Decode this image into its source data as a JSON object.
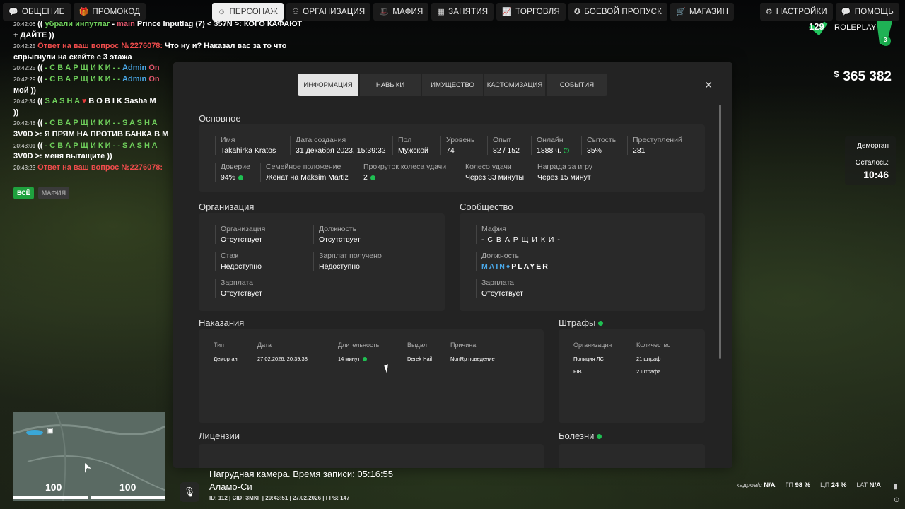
{
  "topbar": {
    "left": [
      {
        "icon": "chat-icon",
        "label": "ОБЩЕНИЕ"
      },
      {
        "icon": "promo-icon",
        "label": "ПРОМОКОД"
      }
    ],
    "center": [
      {
        "icon": "person-icon",
        "label": "ПЕРСОНАЖ",
        "active": true
      },
      {
        "icon": "org-icon",
        "label": "ОРГАНИЗАЦИЯ"
      },
      {
        "icon": "mafia-icon",
        "label": "МАФИЯ"
      },
      {
        "icon": "jobs-icon",
        "label": "ЗАНЯТИЯ"
      },
      {
        "icon": "chart-icon",
        "label": "ТОРГОВЛЯ"
      },
      {
        "icon": "pass-icon",
        "label": "БОЕВОЙ ПРОПУСК"
      },
      {
        "icon": "cart-icon",
        "label": "МАГАЗИН"
      }
    ],
    "right": [
      {
        "icon": "gear-icon",
        "label": "НАСТРОЙКИ"
      },
      {
        "icon": "help-icon",
        "label": "ПОМОЩЬ"
      }
    ]
  },
  "chat": {
    "lines": [
      {
        "ts": "20:42:06",
        "parts": [
          {
            "t": "(( ",
            "c": "#ffffff"
          },
          {
            "t": "убрали инпутлаг",
            "c": "#6fcf5b"
          },
          {
            "t": " - ",
            "c": "#ffffff"
          },
          {
            "t": "main",
            "c": "#e0556b"
          },
          {
            "t": " Prince Inputlag (7) < 357N >: КОГО КАФАЮТ",
            "c": "#ffffff"
          }
        ]
      },
      {
        "ts": "",
        "parts": [
          {
            "t": "+ ДАЙТЕ ))",
            "c": "#ffffff"
          }
        ]
      },
      {
        "ts": "20:42:25",
        "parts": [
          {
            "t": "Ответ на ваш вопрос №2276078:",
            "c": "#ef4c4c"
          },
          {
            "t": " Что ну и? Наказал вас за то что",
            "c": "#ffffff"
          }
        ]
      },
      {
        "ts": "",
        "parts": [
          {
            "t": "спрыгнули на скейте с 3 этажа",
            "c": "#ffffff"
          }
        ]
      },
      {
        "ts": "20:42:25",
        "parts": [
          {
            "t": "(( ",
            "c": "#ffffff"
          },
          {
            "t": "- С В А Р Щ И К И - - ",
            "c": "#6fcf5b"
          },
          {
            "t": "Admin",
            "c": "#4aa8e8"
          },
          {
            "t": " On",
            "c": "#e0556b"
          }
        ]
      },
      {
        "ts": "20:42:29",
        "parts": [
          {
            "t": "(( ",
            "c": "#ffffff"
          },
          {
            "t": "- С В А Р Щ И К И - - ",
            "c": "#6fcf5b"
          },
          {
            "t": "Admin",
            "c": "#4aa8e8"
          },
          {
            "t": " On",
            "c": "#e0556b"
          }
        ]
      },
      {
        "ts": "",
        "parts": [
          {
            "t": "мой ))",
            "c": "#ffffff"
          }
        ]
      },
      {
        "ts": "20:42:34",
        "parts": [
          {
            "t": "(( ",
            "c": "#ffffff"
          },
          {
            "t": "S A S H A ",
            "c": "#6fcf5b"
          },
          {
            "t": "♥",
            "c": "#e23b3b"
          },
          {
            "t": " B O B I K Sasha M",
            "c": "#ffffff"
          }
        ]
      },
      {
        "ts": "",
        "parts": [
          {
            "t": "))",
            "c": "#ffffff"
          }
        ]
      },
      {
        "ts": "20:42:48",
        "parts": [
          {
            "t": "(( ",
            "c": "#ffffff"
          },
          {
            "t": "- С В А Р Щ И К И - - S A S H A",
            "c": "#6fcf5b"
          }
        ]
      },
      {
        "ts": "",
        "parts": [
          {
            "t": "3V0D >: Я ПРЯМ НА ПРОТИВ БАНКА В М",
            "c": "#ffffff"
          }
        ]
      },
      {
        "ts": "20:43:01",
        "parts": [
          {
            "t": "(( ",
            "c": "#ffffff"
          },
          {
            "t": "- С В А Р Щ И К И - - S A S H A",
            "c": "#6fcf5b"
          }
        ]
      },
      {
        "ts": "",
        "parts": [
          {
            "t": "3V0D >: меня вытащите ))",
            "c": "#ffffff"
          }
        ]
      },
      {
        "ts": "20:43:23",
        "parts": [
          {
            "t": "Ответ на ваш вопрос №2276078:",
            "c": "#ef4c4c"
          }
        ]
      }
    ],
    "tab_all": "ВСЁ",
    "tab_mafia": "МАФИЯ"
  },
  "modal": {
    "tabs": [
      "ИНФОРМАЦИЯ",
      "НАВЫКИ",
      "ИМУЩЕСТВО",
      "КАСТОМИЗАЦИЯ",
      "СОБЫТИЯ"
    ],
    "close": "✕",
    "basic": {
      "title": "Основное",
      "fields": [
        {
          "label": "Имя",
          "value": "Takahirka Kratos"
        },
        {
          "label": "Дата создания",
          "value": "31 декабря 2023, 15:39:32"
        },
        {
          "label": "Пол",
          "value": "Мужской"
        },
        {
          "label": "Уровень",
          "value": "74"
        },
        {
          "label": "Опыт",
          "value": "82 / 152"
        },
        {
          "label": "Онлайн",
          "value": "1888 ч."
        },
        {
          "label": "Сытость",
          "value": "35%"
        },
        {
          "label": "Преступлений",
          "value": "281"
        },
        {
          "label": "Доверие",
          "value": "94%"
        },
        {
          "label": "Семейное положение",
          "value": "Женат на Maksim Martiz"
        },
        {
          "label": "Прокруток колеса удачи",
          "value": "2"
        },
        {
          "label": "Колесо удачи",
          "value": "Через 33 минуты"
        },
        {
          "label": "Награда за игру",
          "value": "Через 15 минут"
        }
      ]
    },
    "org": {
      "title": "Организация",
      "fields": [
        {
          "label": "Организация",
          "value": "Отсутствует"
        },
        {
          "label": "Должность",
          "value": "Отсутствует"
        },
        {
          "label": "Стаж",
          "value": "Недоступно"
        },
        {
          "label": "Зарплат получено",
          "value": "Недоступно"
        },
        {
          "label": "Зарплата",
          "value": "Отсутствует"
        }
      ]
    },
    "community": {
      "title": "Сообщество",
      "fields": [
        {
          "label": "Мафия",
          "value": "- С В А Р Щ И К И -"
        },
        {
          "label": "Должность",
          "value_a": "MAIN",
          "value_b": "PLAYER"
        },
        {
          "label": "Зарплата",
          "value": "Отсутствует"
        }
      ]
    },
    "punish": {
      "title": "Наказания",
      "headers": [
        "Тип",
        "Дата",
        "Длительность",
        "Выдал",
        "Причина"
      ],
      "rows": [
        [
          "Деморган",
          "27.02.2026, 20:39:38",
          "14 минут",
          "Derek Hail",
          "NonRp поведение"
        ]
      ]
    },
    "fines": {
      "title": "Штрафы",
      "headers": [
        "Организация",
        "Количество"
      ],
      "rows": [
        [
          "Полиция ЛС",
          "21 штраф"
        ],
        [
          "FIB",
          "2 штрафа"
        ]
      ]
    },
    "licenses": {
      "title": "Лицензии"
    },
    "diseases": {
      "title": "Болезни"
    }
  },
  "hud": {
    "money_symbol": "$",
    "money": "365 382",
    "logo_num": "129",
    "logo_text": "ROLEPLAY",
    "logo_badge": "3",
    "demorgan_label": "Деморган",
    "remaining_label": "Осталось:",
    "remaining_time": "10:46",
    "hp": "100",
    "armor": "100",
    "camera": "Нагрудная камера. Время записи: 05:16:55",
    "location": "Аламо-Си",
    "idline": "ID: 112 | CID: ЗМКF | 20:43:51 | 27.02.2026 | FPS: 147",
    "stats": [
      {
        "label": "кадров/с",
        "value": "N/A"
      },
      {
        "label": "ГП",
        "value": "98 %"
      },
      {
        "label": "ЦП",
        "value": "24 %"
      },
      {
        "label": "LAT",
        "value": "N/A"
      }
    ]
  }
}
